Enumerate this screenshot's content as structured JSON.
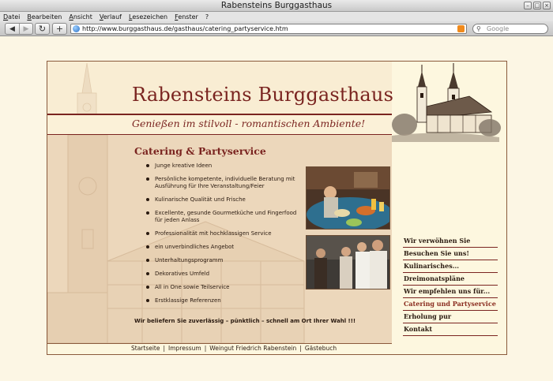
{
  "window": {
    "title": "Rabensteins Burggasthaus"
  },
  "menubar": {
    "items": [
      "Datei",
      "Bearbeiten",
      "Ansicht",
      "Verlauf",
      "Lesezeichen",
      "Fenster",
      "?"
    ]
  },
  "toolbar": {
    "back_icon": "back-arrow-icon",
    "forward_icon": "forward-arrow-icon",
    "reload_icon": "reload-icon",
    "new_tab_icon": "plus-icon",
    "url": "http://www.burggasthaus.de/gasthaus/catering_partyservice.htm",
    "search_placeholder": "Google"
  },
  "header": {
    "title": "Rabensteins Burggasthaus",
    "tagline": "Genießen im stilvoll - romantischen Ambiente!"
  },
  "main": {
    "heading": "Catering & Partyservice",
    "bullets": [
      "Junge kreative Ideen",
      "Persönliche kompetente, individuelle Beratung mit Ausführung für Ihre Veranstaltung/Feier",
      "Kulinarische Qualität und Frische",
      "Excellente, gesunde Gourmetküche und Fingerfood für jeden Anlass",
      "Professionalität mit hochklassigen Service",
      "ein unverbindliches Angebot",
      "Unterhaltungsprogramm",
      "Dekoratives Umfeld",
      "All in One sowie Teilservice",
      "Erstklassige Referenzen"
    ],
    "closing": "Wir beliefern Sie zuverlässig – pünktlich – schnell am Ort Ihrer Wahl !!!"
  },
  "sidebar": {
    "items": [
      "Wir verwöhnen Sie",
      "Besuchen Sie uns!",
      "Kulinarisches...",
      "Dreimonatspläne",
      "Wir empfehlen uns für...",
      "Catering und Partyservice",
      "Erholung pur",
      "Kontakt"
    ],
    "active_index": 5
  },
  "footer": {
    "links": [
      "Startseite",
      "Impressum",
      "Weingut Friedrich Rabenstein",
      "Gästebuch"
    ],
    "separator": "|"
  },
  "colors": {
    "accent": "#7a2420",
    "content_bg": "#ecd7bb",
    "page_bg": "#fdf7df"
  }
}
